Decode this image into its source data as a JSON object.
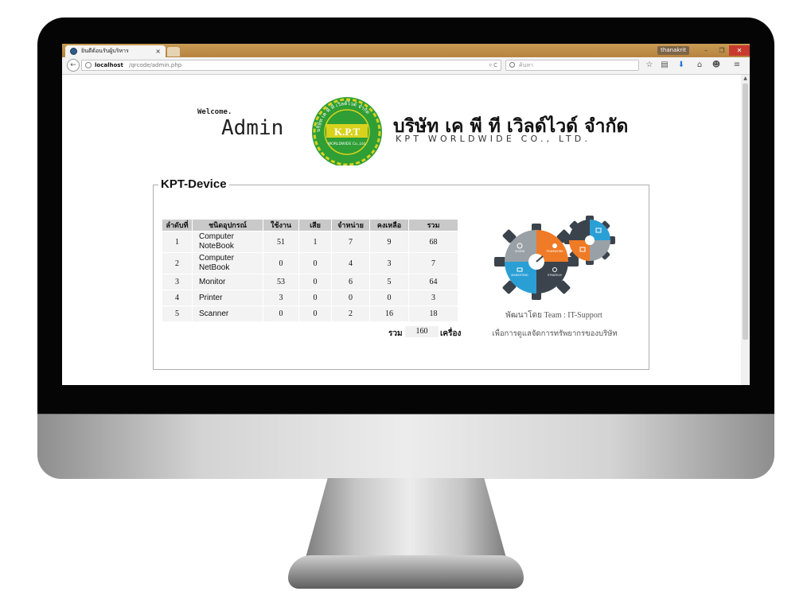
{
  "browser": {
    "tab_title": "ยินดีต้อนรับผู้บริหาร",
    "tab_close": "×",
    "user": "thanakrit",
    "url_host": "localhost",
    "url_path": "/qrcode/admin.php",
    "url_controls": "▿ C",
    "search_placeholder": "ค้นหา",
    "window_min": "–",
    "window_max": "❐",
    "window_close": "✕"
  },
  "header": {
    "welcome": "Welcome.",
    "admin": "Admin",
    "company_th": "บริษัท เค พี ที เวิลด์ไวด์ จำกัด",
    "company_en": "KPT WORLDWIDE CO., LTD.",
    "logo_text": "K.P.T",
    "logo_sub": "WORLDWIDE Co.,Ltd.",
    "logo_ring_text": "บริษัท เค พี ที เวิลด์ไวด์ จำกัด"
  },
  "panel": {
    "title": "KPT-Device",
    "table": {
      "headers": [
        "ลำดับที่",
        "ชนิดอุปกรณ์",
        "ใช้งาน",
        "เสีย",
        "จำหน่าย",
        "คงเหลือ",
        "รวม"
      ],
      "rows": [
        {
          "no": "1",
          "type_line1": "Computer",
          "type_line2": "NoteBook",
          "in_use": "51",
          "broken": "1",
          "sold": "7",
          "remaining": "9",
          "total": "68"
        },
        {
          "no": "2",
          "type_line1": "Computer",
          "type_line2": "NetBook",
          "in_use": "0",
          "broken": "0",
          "sold": "4",
          "remaining": "3",
          "total": "7"
        },
        {
          "no": "3",
          "type_line1": "Monitor",
          "type_line2": "",
          "in_use": "53",
          "broken": "0",
          "sold": "6",
          "remaining": "5",
          "total": "64"
        },
        {
          "no": "4",
          "type_line1": "Printer",
          "type_line2": "",
          "in_use": "3",
          "broken": "0",
          "sold": "0",
          "remaining": "0",
          "total": "3"
        },
        {
          "no": "5",
          "type_line1": "Scanner",
          "type_line2": "",
          "in_use": "0",
          "broken": "0",
          "sold": "2",
          "remaining": "16",
          "total": "18"
        }
      ]
    },
    "summary": {
      "label": "รวม",
      "value": "160",
      "unit": "เครื่อง"
    },
    "developed_by": "พัฒนาโดย Team : IT-Support",
    "purpose": "เพื่อการดูแลจัดการทรัพยากรของบริษัท",
    "gear_labels": {
      "vision": "VISION",
      "teamwork": "TEAMWORK",
      "marketing": "MARKETING",
      "strategy": "STRATEGY"
    }
  },
  "colors": {
    "tab_strip": "#b7833e",
    "gear_orange": "#f07b26",
    "gear_blue": "#2a9fd6",
    "gear_gray": "#9aa1a6",
    "gear_dark": "#3b434c",
    "logo_green": "#2f9e35",
    "logo_yellow": "#d9d21d"
  }
}
